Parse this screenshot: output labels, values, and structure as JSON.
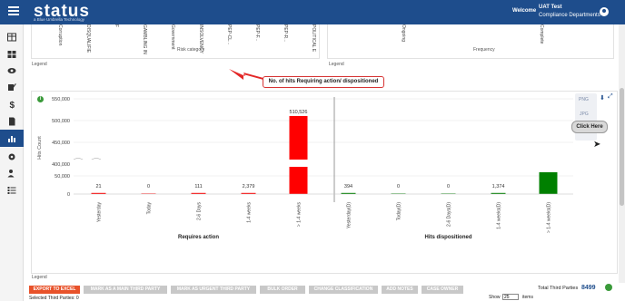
{
  "app": {
    "logo": "status",
    "logo_sub": "a Blue Umbrella Technology",
    "welcome": "Welcome",
    "user_name": "UAT Test",
    "user_dept": "Compliance Departments"
  },
  "top_panels": {
    "risk_category_title": "Risk category",
    "frequency_title": "Frequency",
    "legend_left": "Legend",
    "legend_right": "Legend",
    "risk_labels": [
      "Corruption Bribery",
      "DISQUALIFIED DIRECTOR",
      "F",
      "GAMBLING INTELLIG...",
      "Government Regulatory",
      "INSOLVENCY REGISTER",
      "PEP-CL...",
      "PEP-F...",
      "PEP-R...",
      "POLITICAL EXPOSED PERSON"
    ],
    "frequency_labels": [
      "Ongoing",
      "Complete"
    ]
  },
  "callout": {
    "text": "No. of hits Requiring action/ dispositioned"
  },
  "chart_tools": {
    "png": "PNG",
    "jpg": "JPG",
    "click_here": "Click Here"
  },
  "chart_data": {
    "type": "bar",
    "ylabel": "Hits Count",
    "y_ticks": [
      "550,000",
      "500,000",
      "450,000",
      "400,000",
      "50,000",
      "0"
    ],
    "groups": [
      {
        "title": "Requires action",
        "categories": [
          "Yesterday",
          "Today",
          "2-6 Days",
          "1-4 weeks",
          "> 1-4 weeks"
        ],
        "values": [
          21,
          0,
          111,
          2379,
          510526
        ],
        "labels": [
          "21",
          "0",
          "111",
          "2,379",
          "510,526"
        ],
        "color": "#ff0000"
      },
      {
        "title": "Hits dispositioned",
        "categories": [
          "Yesterday(D)",
          "Today(D)",
          "2-6 Days(D)",
          "1-4 weeks(D)",
          "> 1-4 weeks(D)"
        ],
        "values": [
          394,
          0,
          0,
          1374,
          60000
        ],
        "labels": [
          "394",
          "0",
          "0",
          "1,374",
          ""
        ],
        "color": "#008000"
      }
    ]
  },
  "legend_bottom": "Legend",
  "footer": {
    "buttons": [
      "EXPORT TO EXCEL",
      "MARK AS A MAIN THIRD PARTY",
      "MARK AS URGENT THIRD PARTY",
      "BULK ORDER",
      "CHANGE CLASSIFICATION",
      "ADD NOTES",
      "CASE OWNER"
    ],
    "selected": "Selected Third Parties: 0",
    "total_label": "Total Third Parties",
    "total_value": "8499",
    "show_label": "Show",
    "show_value": "25",
    "items_label": "items"
  },
  "colors": {
    "brand": "#1e4d8c",
    "accent": "#e8522a",
    "requires": "#ff0000",
    "dispositioned": "#008000"
  }
}
